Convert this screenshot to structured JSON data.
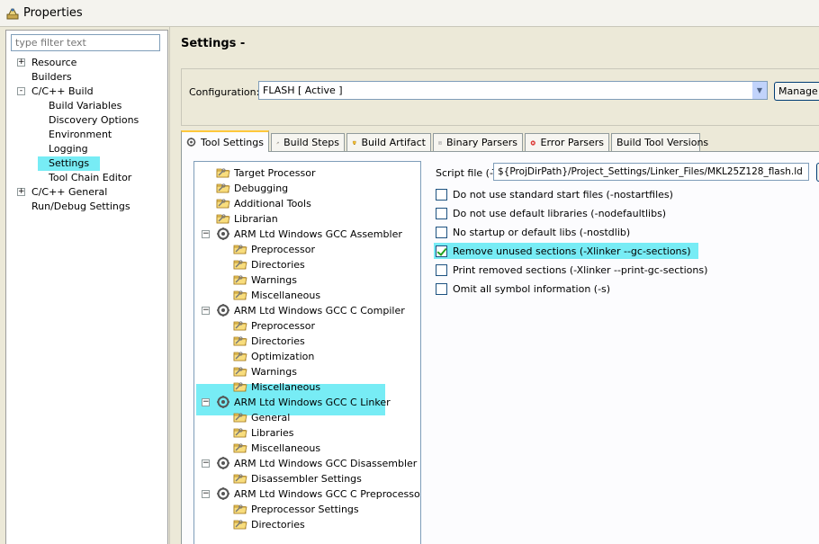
{
  "window": {
    "title": "Properties"
  },
  "left": {
    "filter_placeholder": "type filter text",
    "items": [
      {
        "label": "Resource",
        "expander": "+"
      },
      {
        "label": "Builders"
      },
      {
        "label": "C/C++ Build",
        "expander": "-"
      },
      {
        "label": "Build Variables"
      },
      {
        "label": "Discovery Options"
      },
      {
        "label": "Environment"
      },
      {
        "label": "Logging"
      },
      {
        "label": "Settings",
        "selected": true
      },
      {
        "label": "Tool Chain Editor"
      },
      {
        "label": "C/C++ General",
        "expander": "+"
      },
      {
        "label": "Run/Debug Settings"
      }
    ]
  },
  "right": {
    "header": "Settings -",
    "config_label": "Configuration:",
    "config_value": "FLASH  [ Active ]",
    "manage_label": "Manage Configurations...",
    "tabs": [
      {
        "label": "Tool Settings",
        "icon": "tool-settings-icon",
        "active": true
      },
      {
        "label": "Build Steps",
        "icon": "build-steps-icon"
      },
      {
        "label": "Build Artifact",
        "icon": "build-artifact-icon"
      },
      {
        "label": "Binary Parsers",
        "icon": "binary-parsers-icon"
      },
      {
        "label": "Error Parsers",
        "icon": "error-parsers-icon"
      },
      {
        "label": "Build Tool Versions"
      }
    ],
    "tree": [
      {
        "label": "Target Processor"
      },
      {
        "label": "Debugging"
      },
      {
        "label": "Additional Tools"
      },
      {
        "label": "Librarian"
      },
      {
        "label": "ARM Ltd Windows GCC Assembler"
      },
      {
        "label": "Preprocessor"
      },
      {
        "label": "Directories"
      },
      {
        "label": "Warnings"
      },
      {
        "label": "Miscellaneous"
      },
      {
        "label": "ARM Ltd Windows GCC C Compiler"
      },
      {
        "label": "Preprocessor"
      },
      {
        "label": "Directories"
      },
      {
        "label": "Optimization"
      },
      {
        "label": "Warnings"
      },
      {
        "label": "Miscellaneous"
      },
      {
        "label": "ARM Ltd Windows GCC C Linker"
      },
      {
        "label": "General",
        "selected": true
      },
      {
        "label": "Libraries"
      },
      {
        "label": "Miscellaneous"
      },
      {
        "label": "ARM Ltd Windows GCC Disassembler"
      },
      {
        "label": "Disassembler Settings"
      },
      {
        "label": "ARM Ltd Windows GCC C Preprocessor"
      },
      {
        "label": "Preprocessor Settings"
      },
      {
        "label": "Directories"
      }
    ],
    "script_label": "Script file (-T)",
    "script_value": "${ProjDirPath}/Project_Settings/Linker_Files/MKL25Z128_flash.ld",
    "options": [
      {
        "label": "Do not use standard start files (-nostartfiles)",
        "checked": false
      },
      {
        "label": "Do not use default libraries (-nodefaultlibs)",
        "checked": false
      },
      {
        "label": "No startup or default libs (-nostdlib)",
        "checked": false
      },
      {
        "label": "Remove unused sections (-Xlinker --gc-sections)",
        "checked": true,
        "highlighted": true
      },
      {
        "label": "Print removed sections (-Xlinker --print-gc-sections)",
        "checked": false
      },
      {
        "label": "Omit all symbol information (-s)",
        "checked": false
      }
    ]
  },
  "colors": {
    "highlight": "#77ecf5",
    "checkmark": "#21a121",
    "tab_accent": "#ffc83c"
  }
}
